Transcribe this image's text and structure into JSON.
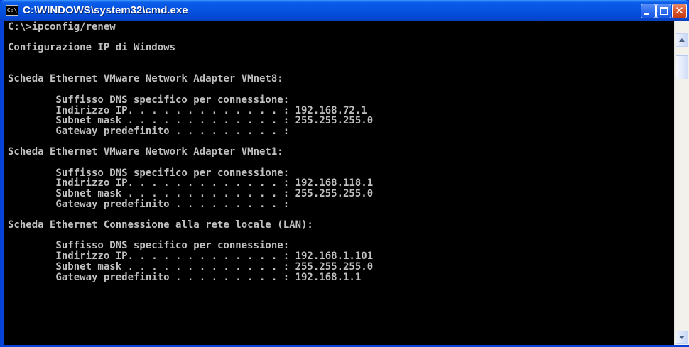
{
  "window": {
    "title": "C:\\WINDOWS\\system32\\cmd.exe",
    "icon_label": "C:\\",
    "icon": "console-app-icon",
    "buttons": {
      "minimize_icon": "minimize-icon",
      "maximize_icon": "maximize-icon",
      "close_icon": "close-icon",
      "close_glyph": "✕"
    }
  },
  "colors": {
    "titlebar": "#0553e0",
    "console_background": "#000000",
    "console_text": "#c0c0c0",
    "close_button": "#d9552c"
  },
  "console": {
    "lines": [
      "C:\\>ipconfig/renew",
      "",
      "Configurazione IP di Windows",
      "",
      "",
      "Scheda Ethernet VMware Network Adapter VMnet8:",
      "",
      "        Suffisso DNS specifico per connessione:",
      "        Indirizzo IP. . . . . . . . . . . . . : 192.168.72.1",
      "        Subnet mask . . . . . . . . . . . . . : 255.255.255.0",
      "        Gateway predefinito . . . . . . . . . :",
      "",
      "Scheda Ethernet VMware Network Adapter VMnet1:",
      "",
      "        Suffisso DNS specifico per connessione:",
      "        Indirizzo IP. . . . . . . . . . . . . : 192.168.118.1",
      "        Subnet mask . . . . . . . . . . . . . : 255.255.255.0",
      "        Gateway predefinito . . . . . . . . . :",
      "",
      "Scheda Ethernet Connessione alla rete locale (LAN):",
      "",
      "        Suffisso DNS specifico per connessione:",
      "        Indirizzo IP. . . . . . . . . . . . . : 192.168.1.101",
      "        Subnet mask . . . . . . . . . . . . . : 255.255.255.0",
      "        Gateway predefinito . . . . . . . . . : 192.168.1.1"
    ]
  },
  "scrollbar": {
    "up_icon": "scroll-up-arrow-icon",
    "down_icon": "scroll-down-arrow-icon"
  }
}
